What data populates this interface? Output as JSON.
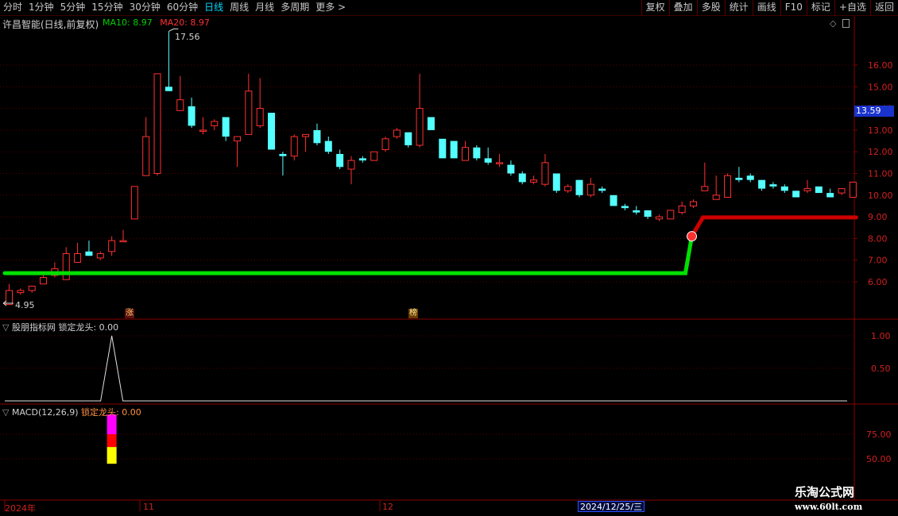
{
  "toolbar": {
    "periods": [
      "分时",
      "1分钟",
      "5分钟",
      "15分钟",
      "30分钟",
      "60分钟",
      "日线",
      "周线",
      "月线",
      "多周期",
      "更多 >"
    ],
    "active_period": "日线",
    "actions": [
      "复权",
      "叠加",
      "多股",
      "统计",
      "画线",
      "F10",
      "标记",
      "+自选",
      "返回"
    ]
  },
  "stock": {
    "title": "许昌智能(日线,前复权)",
    "ma10_label": "MA10: 8.97",
    "ma20_label": "MA20: 8.97",
    "current_price": "13.59",
    "high_mark": "17.56",
    "low_mark": "4.95"
  },
  "tags": {
    "zhang": "涨",
    "bang": "榜"
  },
  "indicator1": {
    "header": "股朋指标网 锁定龙头: 0.00",
    "ticks": [
      "1.00",
      "0.50"
    ]
  },
  "macd": {
    "header_name": "MACD(12,26,9)",
    "header_value": "锁定龙头: 0.00",
    "ticks": [
      "75.00",
      "50.00"
    ]
  },
  "dates": {
    "year": "2024年",
    "m11": "11",
    "m12": "12",
    "cursor": "2024/12/25/三"
  },
  "watermark": {
    "line1": "乐淘公式网",
    "line2": "www.60lt.com"
  },
  "colors": {
    "up": "#ff3030",
    "down": "#54ffff",
    "support_green": "#00e000",
    "support_red": "#cc0000",
    "axis": "#8a0000",
    "grid": "#5a0000"
  },
  "chart_data": {
    "type": "candlestick",
    "price_ticks": [
      16.0,
      15.0,
      14.0,
      13.0,
      12.0,
      11.0,
      10.0,
      9.0,
      8.0,
      7.0,
      6.0
    ],
    "candles": [
      {
        "o": 4.95,
        "h": 5.9,
        "l": 4.95,
        "c": 5.6
      },
      {
        "o": 5.5,
        "h": 5.7,
        "l": 5.4,
        "c": 5.6
      },
      {
        "o": 5.6,
        "h": 5.8,
        "l": 5.5,
        "c": 5.8
      },
      {
        "o": 5.9,
        "h": 6.3,
        "l": 5.9,
        "c": 6.2
      },
      {
        "o": 6.3,
        "h": 6.9,
        "l": 6.2,
        "c": 6.6
      },
      {
        "o": 6.1,
        "h": 7.6,
        "l": 6.1,
        "c": 7.3
      },
      {
        "o": 6.9,
        "h": 7.8,
        "l": 6.9,
        "c": 7.3
      },
      {
        "o": 7.4,
        "h": 7.9,
        "l": 7.2,
        "c": 7.2
      },
      {
        "o": 7.1,
        "h": 7.4,
        "l": 7.0,
        "c": 7.3
      },
      {
        "o": 7.4,
        "h": 8.1,
        "l": 7.2,
        "c": 7.9
      },
      {
        "o": 7.9,
        "h": 8.4,
        "l": 7.9,
        "c": 7.9
      },
      {
        "o": 8.9,
        "h": 10.4,
        "l": 8.9,
        "c": 10.4
      },
      {
        "o": 10.9,
        "h": 13.6,
        "l": 10.9,
        "c": 12.7
      },
      {
        "o": 11.0,
        "h": 15.6,
        "l": 10.9,
        "c": 15.6
      },
      {
        "o": 15.0,
        "h": 17.56,
        "l": 14.8,
        "c": 14.8
      },
      {
        "o": 13.9,
        "h": 15.5,
        "l": 13.9,
        "c": 14.4
      },
      {
        "o": 14.1,
        "h": 14.5,
        "l": 13.1,
        "c": 13.2
      },
      {
        "o": 13.0,
        "h": 13.6,
        "l": 12.8,
        "c": 13.0
      },
      {
        "o": 13.2,
        "h": 13.5,
        "l": 13.0,
        "c": 13.4
      },
      {
        "o": 13.6,
        "h": 13.6,
        "l": 12.5,
        "c": 12.7
      },
      {
        "o": 12.5,
        "h": 12.6,
        "l": 11.3,
        "c": 12.7
      },
      {
        "o": 12.8,
        "h": 15.6,
        "l": 12.8,
        "c": 14.8
      },
      {
        "o": 13.2,
        "h": 15.4,
        "l": 13.1,
        "c": 14.0
      },
      {
        "o": 13.8,
        "h": 13.8,
        "l": 12.1,
        "c": 12.1
      },
      {
        "o": 11.9,
        "h": 12.0,
        "l": 10.9,
        "c": 11.8
      },
      {
        "o": 11.8,
        "h": 12.8,
        "l": 11.6,
        "c": 12.7
      },
      {
        "o": 12.7,
        "h": 12.8,
        "l": 12.0,
        "c": 12.8
      },
      {
        "o": 13.0,
        "h": 13.3,
        "l": 12.3,
        "c": 12.4
      },
      {
        "o": 12.5,
        "h": 12.7,
        "l": 11.9,
        "c": 12.0
      },
      {
        "o": 11.9,
        "h": 12.1,
        "l": 11.2,
        "c": 11.3
      },
      {
        "o": 11.2,
        "h": 11.8,
        "l": 10.5,
        "c": 11.6
      },
      {
        "o": 11.7,
        "h": 11.8,
        "l": 11.5,
        "c": 11.6
      },
      {
        "o": 11.6,
        "h": 12.0,
        "l": 11.6,
        "c": 12.0
      },
      {
        "o": 12.1,
        "h": 12.7,
        "l": 12.0,
        "c": 12.6
      },
      {
        "o": 12.7,
        "h": 13.1,
        "l": 12.6,
        "c": 13.0
      },
      {
        "o": 12.9,
        "h": 12.9,
        "l": 12.2,
        "c": 12.3
      },
      {
        "o": 12.3,
        "h": 15.6,
        "l": 12.2,
        "c": 14.0
      },
      {
        "o": 13.6,
        "h": 13.6,
        "l": 13.0,
        "c": 13.0
      },
      {
        "o": 12.6,
        "h": 12.6,
        "l": 11.7,
        "c": 11.7
      },
      {
        "o": 12.5,
        "h": 12.5,
        "l": 11.7,
        "c": 11.7
      },
      {
        "o": 11.6,
        "h": 12.5,
        "l": 11.6,
        "c": 12.2
      },
      {
        "o": 12.2,
        "h": 12.3,
        "l": 11.6,
        "c": 11.7
      },
      {
        "o": 11.7,
        "h": 12.2,
        "l": 11.4,
        "c": 11.5
      },
      {
        "o": 11.5,
        "h": 11.9,
        "l": 11.3,
        "c": 11.5
      },
      {
        "o": 11.4,
        "h": 11.6,
        "l": 10.9,
        "c": 11.0
      },
      {
        "o": 11.0,
        "h": 11.1,
        "l": 10.5,
        "c": 10.6
      },
      {
        "o": 10.6,
        "h": 10.9,
        "l": 10.5,
        "c": 10.7
      },
      {
        "o": 10.5,
        "h": 11.9,
        "l": 10.4,
        "c": 11.5
      },
      {
        "o": 11.0,
        "h": 11.0,
        "l": 10.1,
        "c": 10.2
      },
      {
        "o": 10.2,
        "h": 10.5,
        "l": 10.1,
        "c": 10.4
      },
      {
        "o": 10.7,
        "h": 10.7,
        "l": 9.9,
        "c": 10.0
      },
      {
        "o": 10.0,
        "h": 10.8,
        "l": 9.9,
        "c": 10.5
      },
      {
        "o": 10.3,
        "h": 10.4,
        "l": 10.1,
        "c": 10.2
      },
      {
        "o": 10.0,
        "h": 10.0,
        "l": 9.5,
        "c": 9.5
      },
      {
        "o": 9.5,
        "h": 9.6,
        "l": 9.3,
        "c": 9.4
      },
      {
        "o": 9.3,
        "h": 9.5,
        "l": 9.1,
        "c": 9.2
      },
      {
        "o": 9.3,
        "h": 9.3,
        "l": 8.9,
        "c": 9.0
      },
      {
        "o": 8.9,
        "h": 9.1,
        "l": 8.8,
        "c": 9.0
      },
      {
        "o": 8.9,
        "h": 9.3,
        "l": 8.9,
        "c": 9.3
      },
      {
        "o": 9.2,
        "h": 9.7,
        "l": 9.1,
        "c": 9.5
      },
      {
        "o": 9.5,
        "h": 9.8,
        "l": 9.4,
        "c": 9.7
      },
      {
        "o": 10.2,
        "h": 11.5,
        "l": 10.2,
        "c": 10.4
      },
      {
        "o": 9.8,
        "h": 10.9,
        "l": 9.8,
        "c": 10.0
      },
      {
        "o": 9.9,
        "h": 11.0,
        "l": 9.9,
        "c": 10.9
      },
      {
        "o": 10.8,
        "h": 11.3,
        "l": 10.6,
        "c": 10.7
      },
      {
        "o": 10.9,
        "h": 11.0,
        "l": 10.6,
        "c": 10.7
      },
      {
        "o": 10.7,
        "h": 10.7,
        "l": 10.2,
        "c": 10.3
      },
      {
        "o": 10.5,
        "h": 10.6,
        "l": 10.3,
        "c": 10.4
      },
      {
        "o": 10.4,
        "h": 10.5,
        "l": 10.1,
        "c": 10.2
      },
      {
        "o": 10.2,
        "h": 10.2,
        "l": 9.9,
        "c": 9.9
      },
      {
        "o": 10.2,
        "h": 10.7,
        "l": 10.1,
        "c": 10.3
      },
      {
        "o": 10.4,
        "h": 10.4,
        "l": 10.1,
        "c": 10.1
      },
      {
        "o": 10.1,
        "h": 10.3,
        "l": 9.9,
        "c": 9.9
      },
      {
        "o": 10.1,
        "h": 10.3,
        "l": 10.0,
        "c": 10.3
      },
      {
        "o": 9.9,
        "h": 10.6,
        "l": 9.9,
        "c": 10.6
      }
    ],
    "support_line": {
      "green_level": 6.4,
      "red_level": 8.97,
      "switch_index": 60
    },
    "indicator_spike": {
      "index": 9,
      "value": 1.0
    },
    "macd_bars": {
      "index": 9,
      "segments": [
        {
          "from": 95,
          "to": 75,
          "color": "#ff00ff"
        },
        {
          "from": 75,
          "to": 62,
          "color": "#ff0000"
        },
        {
          "from": 62,
          "to": 45,
          "color": "#ffff00"
        }
      ]
    }
  }
}
